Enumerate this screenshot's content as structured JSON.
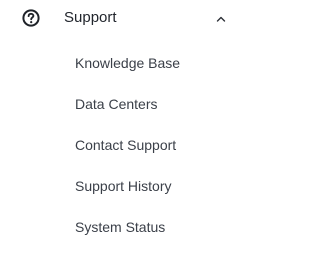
{
  "support_section": {
    "icon": "help-circle-icon",
    "title": "Support",
    "expanded": true,
    "toggle_icon": "chevron-up-icon",
    "items": [
      {
        "label": "Knowledge Base"
      },
      {
        "label": "Data Centers"
      },
      {
        "label": "Contact Support"
      },
      {
        "label": "Support History"
      },
      {
        "label": "System Status"
      }
    ]
  },
  "colors": {
    "text_primary": "#22262d",
    "text_secondary": "#3b4049",
    "background": "#ffffff"
  }
}
